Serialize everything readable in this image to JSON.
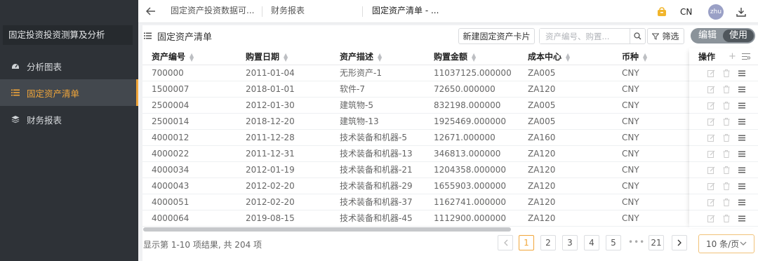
{
  "sidebar": {
    "title": "固定投资投资测算及分析",
    "items": [
      {
        "label": "分析图表",
        "icon": "dashboard-icon"
      },
      {
        "label": "固定资产清单",
        "icon": "list-icon",
        "active": true
      },
      {
        "label": "财务报表",
        "icon": "layers-icon"
      }
    ]
  },
  "topbar": {
    "tabs": [
      "固定资产投资数据可...",
      "财务报表",
      "固定资产清单 - ..."
    ],
    "lang": "CN",
    "user": "zhu"
  },
  "panel": {
    "title": "固定资产清单",
    "new_button": "新建固定资产卡片",
    "search_placeholder": "资产编号、购置...",
    "filter_button": "筛选",
    "toggle": {
      "edit": "编辑",
      "use": "使用"
    }
  },
  "table": {
    "columns": [
      "资产编号",
      "购置日期",
      "资产描述",
      "购置金额",
      "成本中心",
      "币种"
    ],
    "ops_header": "操作",
    "rows": [
      [
        "700000",
        "2011-01-04",
        "无形资产-1",
        "11037125.000000",
        "ZA005",
        "CNY"
      ],
      [
        "1500007",
        "2018-01-01",
        "软件-7",
        "72650.000000",
        "ZA120",
        "CNY"
      ],
      [
        "2500004",
        "2012-01-30",
        "建筑物-5",
        "832198.000000",
        "ZA005",
        "CNY"
      ],
      [
        "2500014",
        "2018-12-20",
        "建筑物-13",
        "1925469.000000",
        "ZA005",
        "CNY"
      ],
      [
        "4000012",
        "2011-12-28",
        "技术装备和机器-5",
        "12671.000000",
        "ZA160",
        "CNY"
      ],
      [
        "4000022",
        "2011-12-31",
        "技术装备和机器-13",
        "346813.000000",
        "ZA120",
        "CNY"
      ],
      [
        "4000034",
        "2012-01-19",
        "技术装备和机器-21",
        "1204358.000000",
        "ZA120",
        "CNY"
      ],
      [
        "4000043",
        "2012-02-20",
        "技术装备和机器-29",
        "1655903.000000",
        "ZA120",
        "CNY"
      ],
      [
        "4000051",
        "2012-02-20",
        "技术装备和机器-37",
        "1162741.000000",
        "ZA120",
        "CNY"
      ],
      [
        "4000064",
        "2019-08-15",
        "技术装备和机器-45",
        "1112900.000000",
        "ZA120",
        "CNY"
      ]
    ]
  },
  "footer": {
    "summary": "显示第 1-10 项结果, 共 204 项",
    "pages": [
      "1",
      "2",
      "3",
      "4",
      "5"
    ],
    "ellipsis": "•••",
    "last_page": "21",
    "page_size": "10 条/页"
  },
  "colors": {
    "accent": "#f1a63a",
    "sidebar": "#2e3237"
  }
}
